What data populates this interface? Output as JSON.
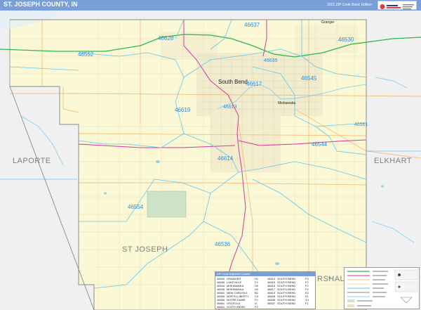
{
  "header": {
    "title": "ST. JOSEPH COUNTY, IN",
    "subtitle": "2021 ZIP Code Basic Edition"
  },
  "regions": {
    "laporte": "LAPORTE",
    "elkhart": "ELKHART",
    "st_joseph": "ST JOSEPH",
    "marshall": "RSHALL"
  },
  "cities": {
    "south_bend": "South Bend",
    "granger": "Granger",
    "mishawaka": "Mishawaka"
  },
  "zip_codes": [
    "46637",
    "46628",
    "46530",
    "46552",
    "46635",
    "46617",
    "46545",
    "46619",
    "46613",
    "46561",
    "46544",
    "46614",
    "46554",
    "46536"
  ],
  "zip_index": {
    "heading": "ZIP Code Adjacent Locator",
    "columns": [
      [
        {
          "zip": "46530",
          "name": "GRANGER",
          "loc": "H1"
        },
        {
          "zip": "46536",
          "name": "LAKEVILLE",
          "loc": "F4"
        },
        {
          "zip": "46544",
          "name": "MISHAWAKA",
          "loc": "H2"
        },
        {
          "zip": "46545",
          "name": "MISHAWAKA",
          "loc": "H2"
        },
        {
          "zip": "46552",
          "name": "NEW CARLISLE",
          "loc": "B2"
        },
        {
          "zip": "46554",
          "name": "NORTH LIBERTY",
          "loc": "C3"
        },
        {
          "zip": "46556",
          "name": "NOTRE DAME",
          "loc": "F2"
        },
        {
          "zip": "46561",
          "name": "OSCEOLA",
          "loc": "I2"
        },
        {
          "zip": "46601",
          "name": "SOUTH BEND",
          "loc": "F2"
        },
        {
          "zip": "46613",
          "name": "SOUTH BEND",
          "loc": "F2"
        }
      ],
      [
        {
          "zip": "46614",
          "name": "SOUTH BEND",
          "loc": "F3"
        },
        {
          "zip": "46615",
          "name": "SOUTH BEND",
          "loc": "F2"
        },
        {
          "zip": "46616",
          "name": "SOUTH BEND",
          "loc": "F2"
        },
        {
          "zip": "46617",
          "name": "SOUTH BEND",
          "loc": "F2"
        },
        {
          "zip": "46619",
          "name": "SOUTH BEND",
          "loc": "E2"
        },
        {
          "zip": "46628",
          "name": "SOUTH BEND",
          "loc": "E1"
        },
        {
          "zip": "46635",
          "name": "SOUTH BEND",
          "loc": "G1"
        },
        {
          "zip": "46637",
          "name": "SOUTH BEND",
          "loc": "F1"
        }
      ]
    ]
  },
  "colors": {
    "header_band": "#7a9fd8",
    "county_fill": "#fbf8d6",
    "outside_fill": "#f0f0f0",
    "zip_boundary": "#63c7ec",
    "zip_label": "#2d8de0",
    "interstate": "#2eb84a",
    "highway": "#d6369c",
    "major_road": "#f0c080",
    "water": "#8fd0ee",
    "park": "#cfe3c8"
  }
}
